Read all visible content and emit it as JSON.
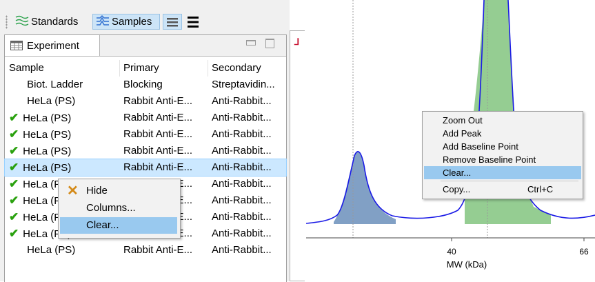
{
  "toolbar": {
    "standards_label": "Standards",
    "samples_label": "Samples",
    "collapse_icon": "collapse-rows-icon",
    "expand_icon": "expand-rows-icon"
  },
  "experiment_tab": {
    "label": "Experiment"
  },
  "table": {
    "columns": [
      "Sample",
      "Primary",
      "Secondary"
    ],
    "rows": [
      {
        "checked": false,
        "sample": "Biot. Ladder",
        "primary": "Blocking",
        "secondary": "Streptavidin..."
      },
      {
        "checked": false,
        "sample": "HeLa (PS)",
        "primary": "Rabbit Anti-E...",
        "secondary": "Anti-Rabbit..."
      },
      {
        "checked": true,
        "sample": "HeLa (PS)",
        "primary": "Rabbit Anti-E...",
        "secondary": "Anti-Rabbit..."
      },
      {
        "checked": true,
        "sample": "HeLa (PS)",
        "primary": "Rabbit Anti-E...",
        "secondary": "Anti-Rabbit..."
      },
      {
        "checked": true,
        "sample": "HeLa (PS)",
        "primary": "Rabbit Anti-E...",
        "secondary": "Anti-Rabbit..."
      },
      {
        "checked": true,
        "sample": "HeLa (PS)",
        "primary": "Rabbit Anti-E...",
        "secondary": "Anti-Rabbit..."
      },
      {
        "checked": true,
        "sample": "HeLa (PS)",
        "primary": "Rabbit Anti-E...",
        "secondary": "Anti-Rabbit..."
      },
      {
        "checked": true,
        "sample": "HeLa (PS)",
        "primary": "Rabbit Anti-E...",
        "secondary": "Anti-Rabbit..."
      },
      {
        "checked": true,
        "sample": "HeLa (PS)",
        "primary": "Rabbit Anti-E...",
        "secondary": "Anti-Rabbit..."
      },
      {
        "checked": true,
        "sample": "HeLa (PS)",
        "primary": "Rabbit Anti-E...",
        "secondary": "Anti-Rabbit..."
      },
      {
        "checked": false,
        "sample": "HeLa (PS)",
        "primary": "Rabbit Anti-E...",
        "secondary": "Anti-Rabbit..."
      }
    ],
    "selected_row": 5
  },
  "context_menu_left": {
    "items": [
      {
        "label": "Hide",
        "icon": "x-icon"
      },
      {
        "label": "Columns..."
      },
      {
        "label": "Clear..."
      }
    ],
    "highlighted": 2
  },
  "context_menu_right": {
    "items": [
      {
        "label": "Zoom Out"
      },
      {
        "label": "Add Peak"
      },
      {
        "label": "Add Baseline Point"
      },
      {
        "label": "Remove Baseline Point"
      },
      {
        "label": "Clear..."
      },
      {
        "label": "Copy...",
        "shortcut": "Ctrl+C"
      }
    ],
    "highlighted": 4
  },
  "electropherogram": {
    "x_label": "MW (kDa)",
    "x_ticks": [
      "40",
      "66"
    ],
    "line_color": "#1a1ae6",
    "peak_fills": [
      "#7a9bc2",
      "#8fca8c"
    ]
  },
  "colors": {
    "selection": "#cce8ff",
    "menu_highlight": "#99c9ef",
    "check": "#2aa10f"
  }
}
